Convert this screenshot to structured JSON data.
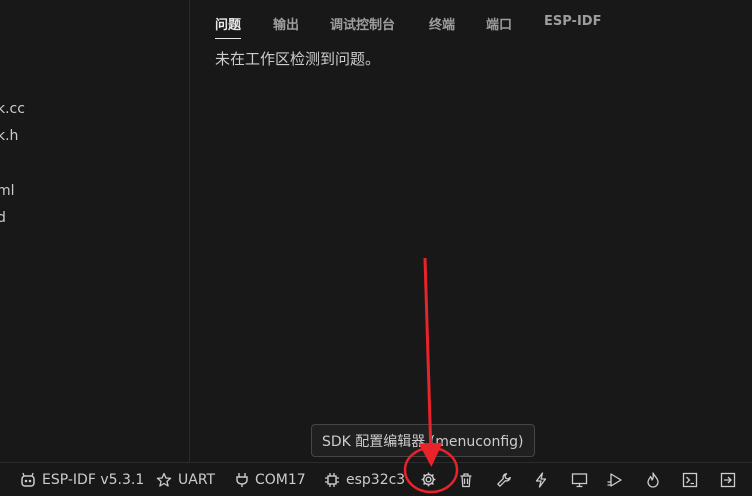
{
  "sidebar": {
    "files": [
      {
        "label": "k.cc"
      },
      {
        "label": "k.h"
      },
      {
        "label": "ml"
      },
      {
        "label": "d"
      }
    ]
  },
  "panel": {
    "tabs": [
      {
        "label": "问题",
        "active": true
      },
      {
        "label": "输出",
        "active": false
      },
      {
        "label": "调试控制台",
        "active": false
      },
      {
        "label": "终端",
        "active": false
      },
      {
        "label": "端口",
        "active": false
      },
      {
        "label": "ESP-IDF",
        "active": false
      }
    ],
    "message": "未在工作区检测到问题。"
  },
  "statusbar": {
    "idf_version": "ESP-IDF v5.3.1",
    "flash_method": "UART",
    "port": "COM17",
    "target": "esp32c3",
    "icons": [
      "gear-icon",
      "trash-icon",
      "wrench-icon",
      "lightning-icon",
      "monitor-icon",
      "debug-icon",
      "flame-icon",
      "terminal-icon",
      "exit-icon"
    ]
  },
  "tooltip": "SDK 配置编辑器 (menuconfig)",
  "annotation": {
    "color": "#e8232a"
  }
}
